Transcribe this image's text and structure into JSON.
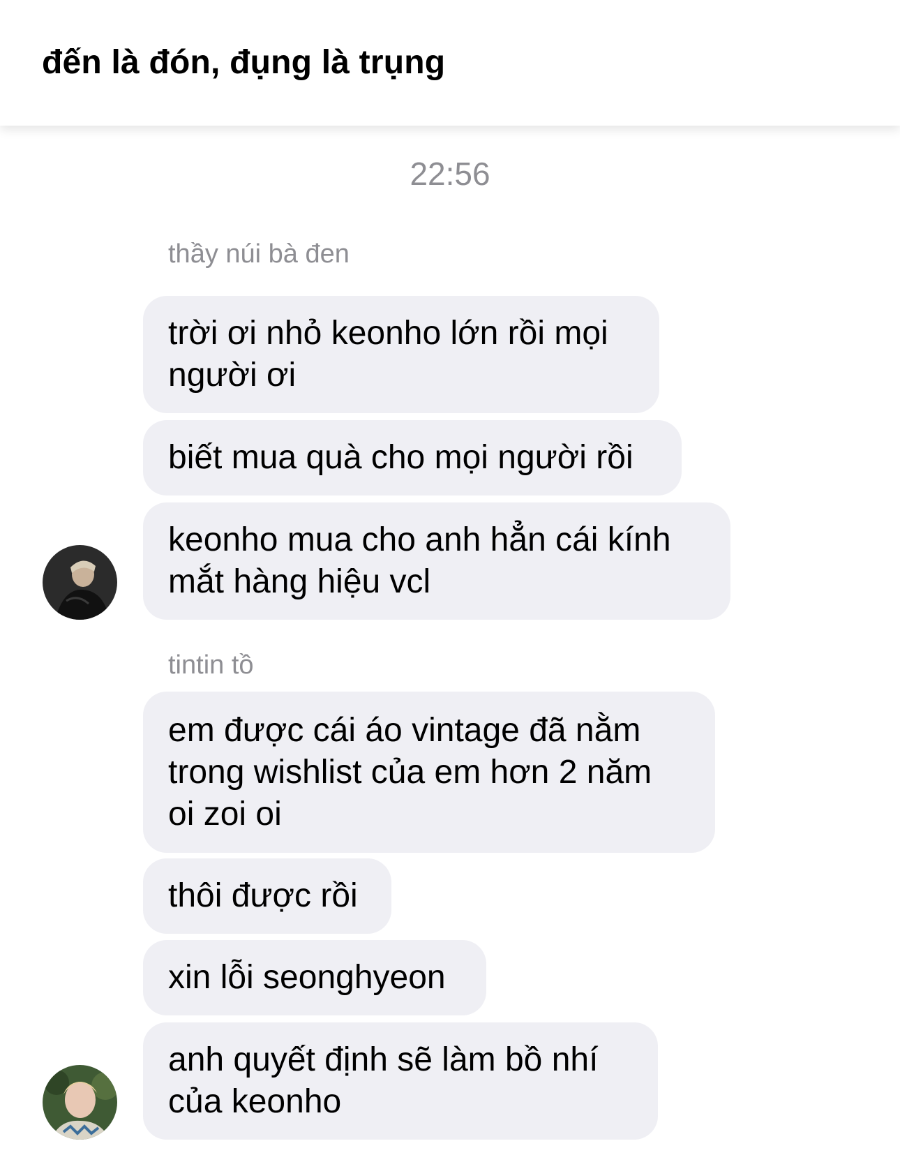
{
  "header": {
    "title": "đến là đón, đụng là trụng"
  },
  "timestamp": "22:56",
  "groups": [
    {
      "sender": "thầy núi bà đen",
      "messages": [
        {
          "lines": [
            "trời ơi nhỏ keonho lớn rồi mọi",
            "người ơi"
          ]
        },
        {
          "lines": [
            "biết mua quà cho mọi người rồi"
          ]
        },
        {
          "lines": [
            "keonho mua cho anh hẳn cái kính",
            "mắt hàng hiệu vcl"
          ]
        }
      ]
    },
    {
      "sender": "tintin tồ",
      "messages": [
        {
          "lines": [
            "em được cái áo vintage đã nằm",
            "trong wishlist của em hơn 2 năm",
            "oi zoi oi"
          ]
        },
        {
          "lines": [
            "thôi được rồi"
          ]
        },
        {
          "lines": [
            "xin lỗi seonghyeon"
          ]
        },
        {
          "lines": [
            "anh quyết định sẽ làm bồ nhí",
            "của keonho"
          ]
        }
      ]
    }
  ],
  "colors": {
    "bubble": "#efeff4",
    "meta_text": "#8e8e93",
    "background": "#ffffff"
  }
}
